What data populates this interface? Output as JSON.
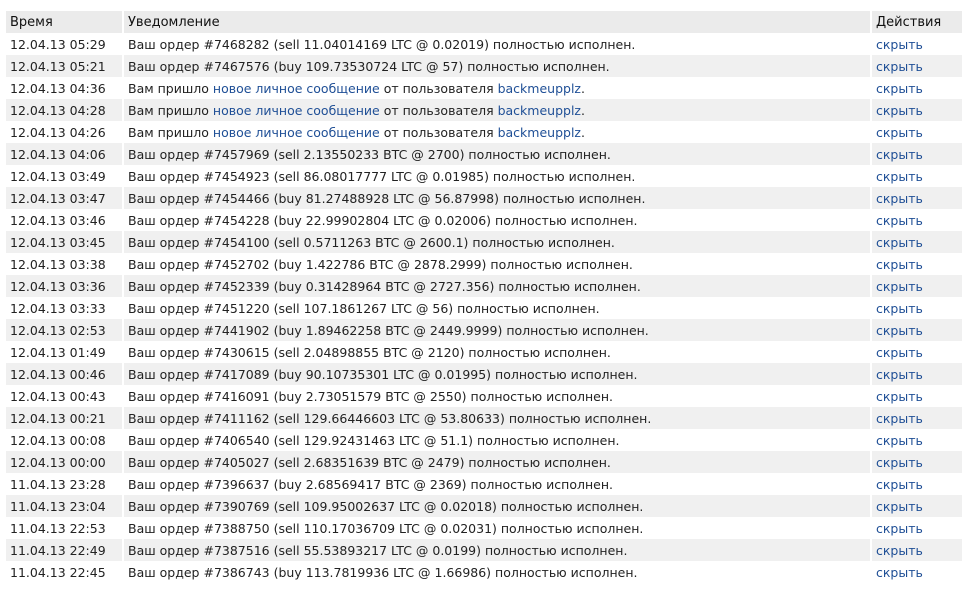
{
  "header": {
    "time": "Время",
    "notification": "Уведомление",
    "actions": "Действия"
  },
  "hide_label": "скрыть",
  "rows": [
    {
      "time": "12.04.13 05:29",
      "type": "order",
      "text": "Ваш ордер #7468282 (sell 11.04014169 LTC @ 0.02019) полностью исполнен."
    },
    {
      "time": "12.04.13 05:21",
      "type": "order",
      "text": "Ваш ордер #7467576 (buy 109.73530724 LTC @ 57) полностью исполнен."
    },
    {
      "time": "12.04.13 04:36",
      "type": "message",
      "prefix": "Вам пришло ",
      "link": "новое личное сообщение",
      "middle": " от пользователя ",
      "user": "backmeupplz",
      "suffix": "."
    },
    {
      "time": "12.04.13 04:28",
      "type": "message",
      "prefix": "Вам пришло ",
      "link": "новое личное сообщение",
      "middle": " от пользователя ",
      "user": "backmeupplz",
      "suffix": "."
    },
    {
      "time": "12.04.13 04:26",
      "type": "message",
      "prefix": "Вам пришло ",
      "link": "новое личное сообщение",
      "middle": " от пользователя ",
      "user": "backmeupplz",
      "suffix": "."
    },
    {
      "time": "12.04.13 04:06",
      "type": "order",
      "text": "Ваш ордер #7457969 (sell 2.13550233 BTC @ 2700) полностью исполнен."
    },
    {
      "time": "12.04.13 03:49",
      "type": "order",
      "text": "Ваш ордер #7454923 (sell 86.08017777 LTC @ 0.01985) полностью исполнен."
    },
    {
      "time": "12.04.13 03:47",
      "type": "order",
      "text": "Ваш ордер #7454466 (buy 81.27488928 LTC @ 56.87998) полностью исполнен."
    },
    {
      "time": "12.04.13 03:46",
      "type": "order",
      "text": "Ваш ордер #7454228 (buy 22.99902804 LTC @ 0.02006) полностью исполнен."
    },
    {
      "time": "12.04.13 03:45",
      "type": "order",
      "text": "Ваш ордер #7454100 (sell 0.5711263 BTC @ 2600.1) полностью исполнен."
    },
    {
      "time": "12.04.13 03:38",
      "type": "order",
      "text": "Ваш ордер #7452702 (buy 1.422786 BTC @ 2878.2999) полностью исполнен."
    },
    {
      "time": "12.04.13 03:36",
      "type": "order",
      "text": "Ваш ордер #7452339 (buy 0.31428964 BTC @ 2727.356) полностью исполнен."
    },
    {
      "time": "12.04.13 03:33",
      "type": "order",
      "text": "Ваш ордер #7451220 (sell 107.1861267 LTC @ 56) полностью исполнен."
    },
    {
      "time": "12.04.13 02:53",
      "type": "order",
      "text": "Ваш ордер #7441902 (buy 1.89462258 BTC @ 2449.9999) полностью исполнен."
    },
    {
      "time": "12.04.13 01:49",
      "type": "order",
      "text": "Ваш ордер #7430615 (sell 2.04898855 BTC @ 2120) полностью исполнен."
    },
    {
      "time": "12.04.13 00:46",
      "type": "order",
      "text": "Ваш ордер #7417089 (buy 90.10735301 LTC @ 0.01995) полностью исполнен."
    },
    {
      "time": "12.04.13 00:43",
      "type": "order",
      "text": "Ваш ордер #7416091 (buy 2.73051579 BTC @ 2550) полностью исполнен."
    },
    {
      "time": "12.04.13 00:21",
      "type": "order",
      "text": "Ваш ордер #7411162 (sell 129.66446603 LTC @ 53.80633) полностью исполнен."
    },
    {
      "time": "12.04.13 00:08",
      "type": "order",
      "text": "Ваш ордер #7406540 (sell 129.92431463 LTC @ 51.1) полностью исполнен."
    },
    {
      "time": "12.04.13 00:00",
      "type": "order",
      "text": "Ваш ордер #7405027 (sell 2.68351639 BTC @ 2479) полностью исполнен."
    },
    {
      "time": "11.04.13 23:28",
      "type": "order",
      "text": "Ваш ордер #7396637 (buy 2.68569417 BTC @ 2369) полностью исполнен."
    },
    {
      "time": "11.04.13 23:04",
      "type": "order",
      "text": "Ваш ордер #7390769 (sell 109.95002637 LTC @ 0.02018) полностью исполнен."
    },
    {
      "time": "11.04.13 22:53",
      "type": "order",
      "text": "Ваш ордер #7388750 (sell 110.17036709 LTC @ 0.02031) полностью исполнен."
    },
    {
      "time": "11.04.13 22:49",
      "type": "order",
      "text": "Ваш ордер #7387516 (sell 55.53893217 LTC @ 0.0199) полностью исполнен."
    },
    {
      "time": "11.04.13 22:45",
      "type": "order",
      "text": "Ваш ордер #7386743 (buy 113.7819936 LTC @ 1.66986) полностью исполнен."
    }
  ]
}
